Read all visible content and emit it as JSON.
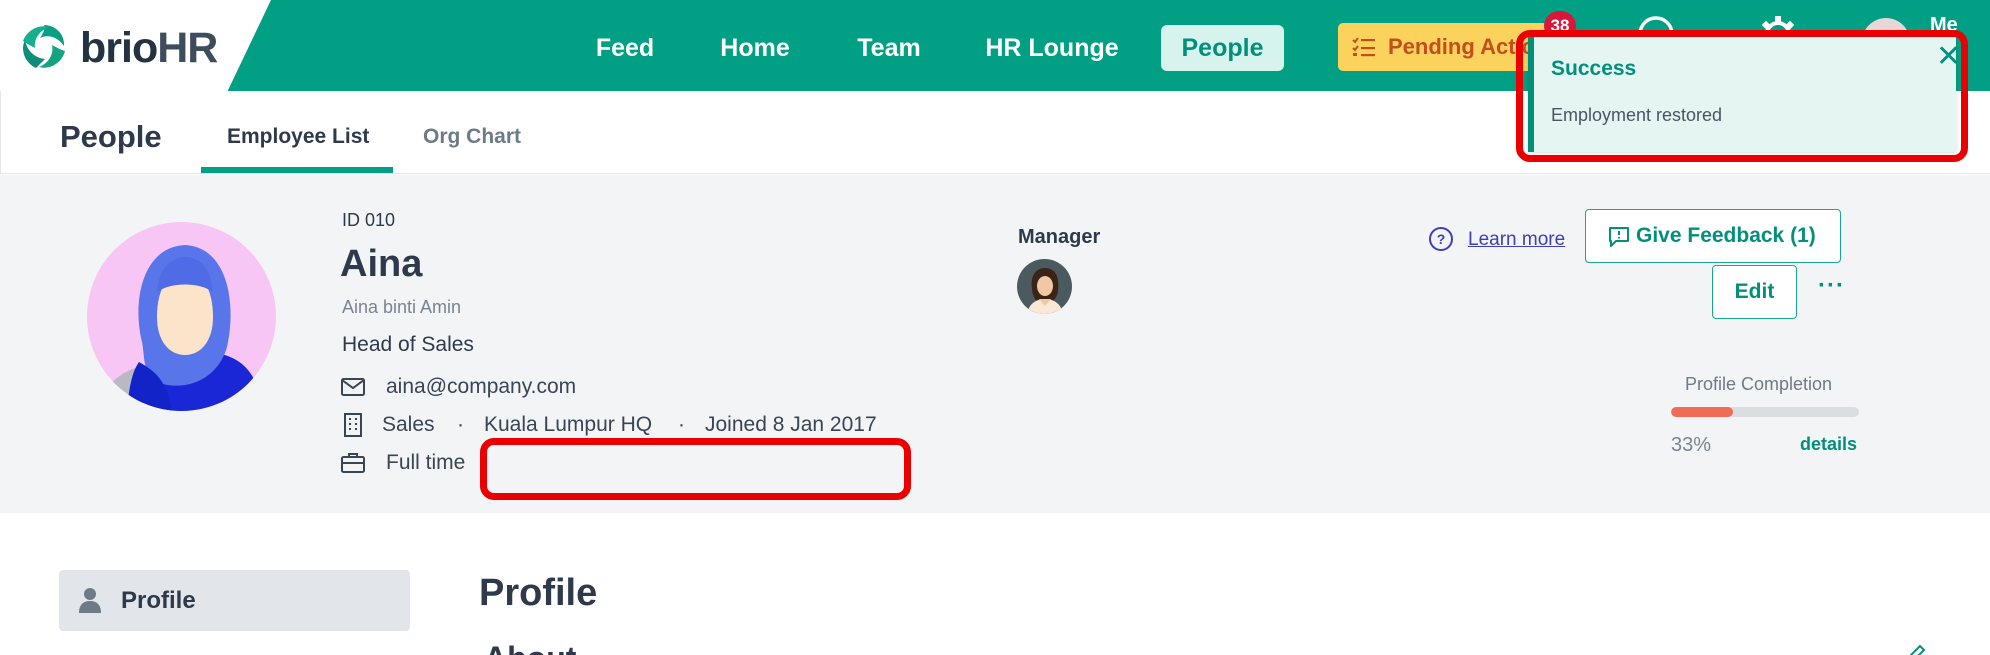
{
  "brand": {
    "name_bold": "brio",
    "name_hr": "HR",
    "accent": "#01a084"
  },
  "nav": {
    "items": [
      {
        "label": "Feed"
      },
      {
        "label": "Home"
      },
      {
        "label": "Team"
      },
      {
        "label": "HR Lounge"
      },
      {
        "label": "People"
      }
    ],
    "active": "People",
    "pending_label": "Pending Actio",
    "notification_count": "38",
    "help_icon": "help-circle-icon",
    "settings_icon": "gear-icon",
    "me_label": "Me"
  },
  "subheader": {
    "title": "People",
    "tabs": [
      {
        "label": "Employee List"
      },
      {
        "label": "Org Chart"
      }
    ],
    "active_tab": "Employee List"
  },
  "employee": {
    "id_label": "ID 010",
    "name": "Aina",
    "full_name": "Aina binti Amin",
    "title": "Head of Sales",
    "email": "aina@company.com",
    "department": "Sales",
    "location": "Kuala Lumpur HQ",
    "joined": "Joined 8 Jan 2017",
    "employment_type": "Full time",
    "separator": "·"
  },
  "manager": {
    "label": "Manager"
  },
  "actions": {
    "learn_more": "Learn more",
    "give_feedback": "Give Feedback (1)",
    "edit": "Edit",
    "more": "···"
  },
  "profile_completion": {
    "label": "Profile Completion",
    "percent_text": "33%",
    "percent_value": 33,
    "details_label": "details",
    "bar_color": "#f06d55"
  },
  "sidebar": {
    "profile_label": "Profile"
  },
  "main": {
    "section_title": "Profile",
    "subsection_title": "About"
  },
  "toast": {
    "title": "Success",
    "message": "Employment restored",
    "close": "✕"
  }
}
